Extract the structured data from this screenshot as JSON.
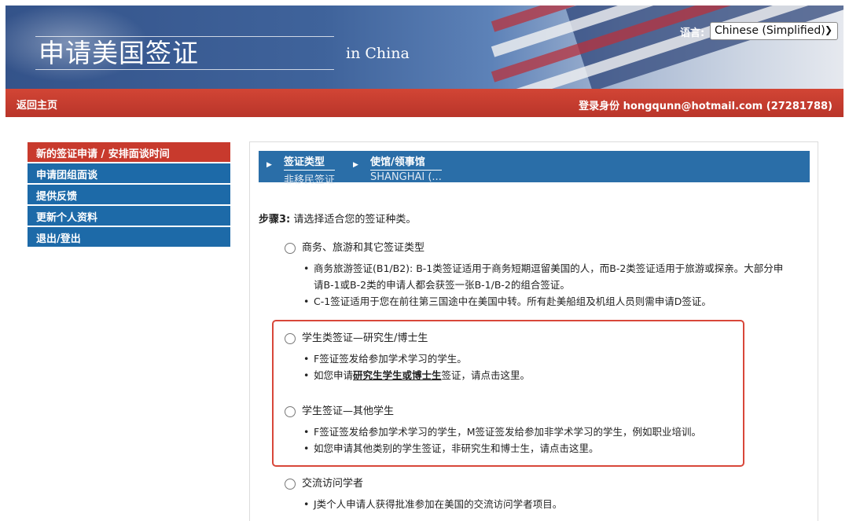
{
  "header": {
    "title": "申请美国签证",
    "subtitle": "in China",
    "language_label": "语言:",
    "language_selected": "Chinese (Simplified)"
  },
  "navbar": {
    "home_link": "返回主页",
    "login_prefix": "登录身份",
    "email": "hongqunn@hotmail.com",
    "account_id": "(27281788)"
  },
  "sidebar": {
    "items": [
      {
        "label": "新的签证申请 / 安排面谈时间",
        "active": true
      },
      {
        "label": "申请团组面谈",
        "active": false
      },
      {
        "label": "提供反馈",
        "active": false
      },
      {
        "label": "更新个人资料",
        "active": false
      },
      {
        "label": "退出/登出",
        "active": false
      }
    ]
  },
  "breadcrumb": {
    "items": [
      {
        "label": "签证类型",
        "value": "非移民签证"
      },
      {
        "label": "使馆/领事馆",
        "value": "SHANGHAI (..."
      }
    ]
  },
  "step": {
    "prefix": "步骤3:",
    "text": " 请选择适合您的签证种类。"
  },
  "options": [
    {
      "label": "商务、旅游和其它签证类型",
      "bullets": [
        "商务旅游签证(B1/B2): B-1类签证适用于商务短期逗留美国的人，而B-2类签证适用于旅游或探亲。大部分申请B-1或B-2类的申请人都会获签一张B-1/B-2的组合签证。",
        "C-1签证适用于您在前往第三国途中在美国中转。所有赴美船组及机组人员则需申请D签证。"
      ]
    },
    {
      "label": "学生类签证—研究生/博士生",
      "bullets": [
        "F签证签发给参加学术学习的学生。"
      ],
      "link_bullet": {
        "before": "如您申请",
        "link": "研究生学生或博士生",
        "after": "签证，请点击这里。"
      }
    },
    {
      "label": "学生签证—其他学生",
      "bullets": [
        "F签证签发给参加学术学习的学生，M签证签发给参加非学术学习的学生，例如职业培训。",
        "如您申请其他类别的学生签证，非研究生和博士生，请点击这里。"
      ]
    },
    {
      "label": "交流访问学者",
      "bullets": [
        "J类个人申请人获得批准参加在美国的交流访问学者项目。"
      ]
    }
  ],
  "colors": {
    "nav_red": "#c83a2d",
    "menu_blue": "#1d6aa8",
    "highlight_red": "#d8473a"
  }
}
